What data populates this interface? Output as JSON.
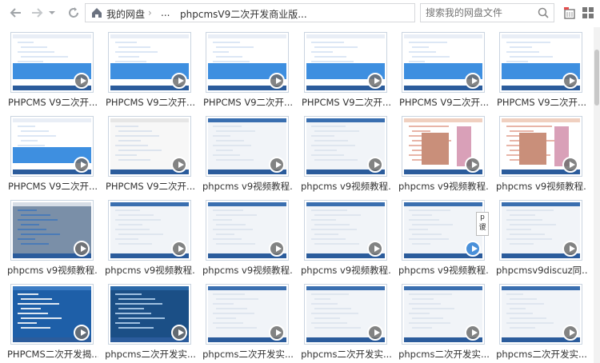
{
  "nav": {
    "back_icon": "back-arrow-icon",
    "forward_icon": "forward-arrow-icon",
    "history_icon": "chevron-down-icon",
    "refresh_icon": "refresh-icon"
  },
  "breadcrumb": {
    "home": "我的网盘",
    "ellipsis": "...",
    "current": "phpcmsV9二次开发商业版..."
  },
  "search": {
    "placeholder": "搜索我的网盘文件"
  },
  "colors": {
    "accent": "#2e7bd6",
    "border": "#c9d4e0",
    "play": "#6e6e6e"
  },
  "items": [
    {
      "label": "PHPCMS V9二次开..."
    },
    {
      "label": "PHPCMS V9二次开..."
    },
    {
      "label": "PHPCMS V9二次开..."
    },
    {
      "label": "PHPCMS V9二次开..."
    },
    {
      "label": "PHPCMS V9二次开..."
    },
    {
      "label": "PHPCMS V9二次开..."
    },
    {
      "label": "PHPCMS V9二次开..."
    },
    {
      "label": "PHPCMS V9二次开..."
    },
    {
      "label": "phpcms v9视频教程..."
    },
    {
      "label": "phpcms v9视频教程..."
    },
    {
      "label": "phpcms v9视频教程..."
    },
    {
      "label": "phpcms v9视频教程..."
    },
    {
      "label": "phpcms v9视频教程..."
    },
    {
      "label": "phpcms v9视频教程..."
    },
    {
      "label": "phpcms v9视频教程..."
    },
    {
      "label": "phpcms v9视频教程..."
    },
    {
      "label": "phpcms v9视频教程..."
    },
    {
      "label": "phpcmsv9discuz同..."
    },
    {
      "label": "PHPCMS二次开发揭..."
    },
    {
      "label": "phpcms二次开发实..."
    },
    {
      "label": "phpcms二次开发实..."
    },
    {
      "label": "phpcms二次开发实..."
    },
    {
      "label": "phpcms二次开发实..."
    },
    {
      "label": "phpcms二次开发实..."
    }
  ],
  "tooltip": {
    "line1": "p",
    "line2": "谡"
  }
}
